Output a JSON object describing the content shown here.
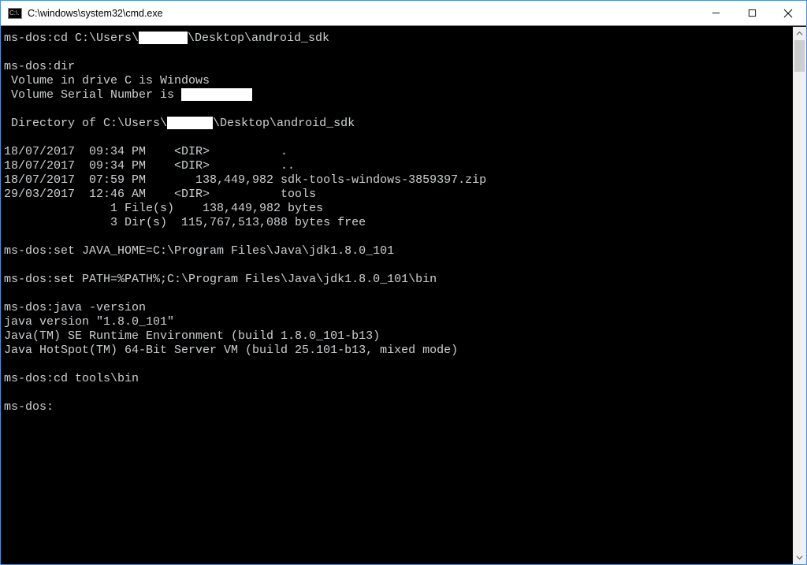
{
  "window": {
    "title": "C:\\windows\\system32\\cmd.exe",
    "icon_text": "C:\\."
  },
  "terminal": {
    "lines": [
      {
        "segs": [
          {
            "t": "ms-dos:cd C:\\Users\\"
          },
          {
            "redact_w": 62
          },
          {
            "t": "\\Desktop\\android_sdk"
          }
        ]
      },
      {
        "segs": []
      },
      {
        "segs": [
          {
            "t": "ms-dos:dir"
          }
        ]
      },
      {
        "segs": [
          {
            "t": " Volume in drive C is Windows"
          }
        ]
      },
      {
        "segs": [
          {
            "t": " Volume Serial Number is "
          },
          {
            "redact_w": 90
          }
        ]
      },
      {
        "segs": []
      },
      {
        "segs": [
          {
            "t": " Directory of C:\\Users\\"
          },
          {
            "redact_w": 58
          },
          {
            "t": "\\Desktop\\android_sdk"
          }
        ]
      },
      {
        "segs": []
      },
      {
        "segs": [
          {
            "t": "18/07/2017  09:34 PM    <DIR>          ."
          }
        ]
      },
      {
        "segs": [
          {
            "t": "18/07/2017  09:34 PM    <DIR>          .."
          }
        ]
      },
      {
        "segs": [
          {
            "t": "18/07/2017  07:59 PM       138,449,982 sdk-tools-windows-3859397.zip"
          }
        ]
      },
      {
        "segs": [
          {
            "t": "29/03/2017  12:46 AM    <DIR>          tools"
          }
        ]
      },
      {
        "segs": [
          {
            "t": "               1 File(s)    138,449,982 bytes"
          }
        ]
      },
      {
        "segs": [
          {
            "t": "               3 Dir(s)  115,767,513,088 bytes free"
          }
        ]
      },
      {
        "segs": []
      },
      {
        "segs": [
          {
            "t": "ms-dos:set JAVA_HOME=C:\\Program Files\\Java\\jdk1.8.0_101"
          }
        ]
      },
      {
        "segs": []
      },
      {
        "segs": [
          {
            "t": "ms-dos:set PATH=%PATH%;C:\\Program Files\\Java\\jdk1.8.0_101\\bin"
          }
        ]
      },
      {
        "segs": []
      },
      {
        "segs": [
          {
            "t": "ms-dos:java -version"
          }
        ]
      },
      {
        "segs": [
          {
            "t": "java version \"1.8.0_101\""
          }
        ]
      },
      {
        "segs": [
          {
            "t": "Java(TM) SE Runtime Environment (build 1.8.0_101-b13)"
          }
        ]
      },
      {
        "segs": [
          {
            "t": "Java HotSpot(TM) 64-Bit Server VM (build 25.101-b13, mixed mode)"
          }
        ]
      },
      {
        "segs": []
      },
      {
        "segs": [
          {
            "t": "ms-dos:cd tools\\bin"
          }
        ]
      },
      {
        "segs": []
      },
      {
        "segs": [
          {
            "t": "ms-dos:"
          }
        ]
      }
    ]
  },
  "buttons": {
    "minimize": "Minimize",
    "maximize": "Maximize",
    "close": "Close"
  }
}
